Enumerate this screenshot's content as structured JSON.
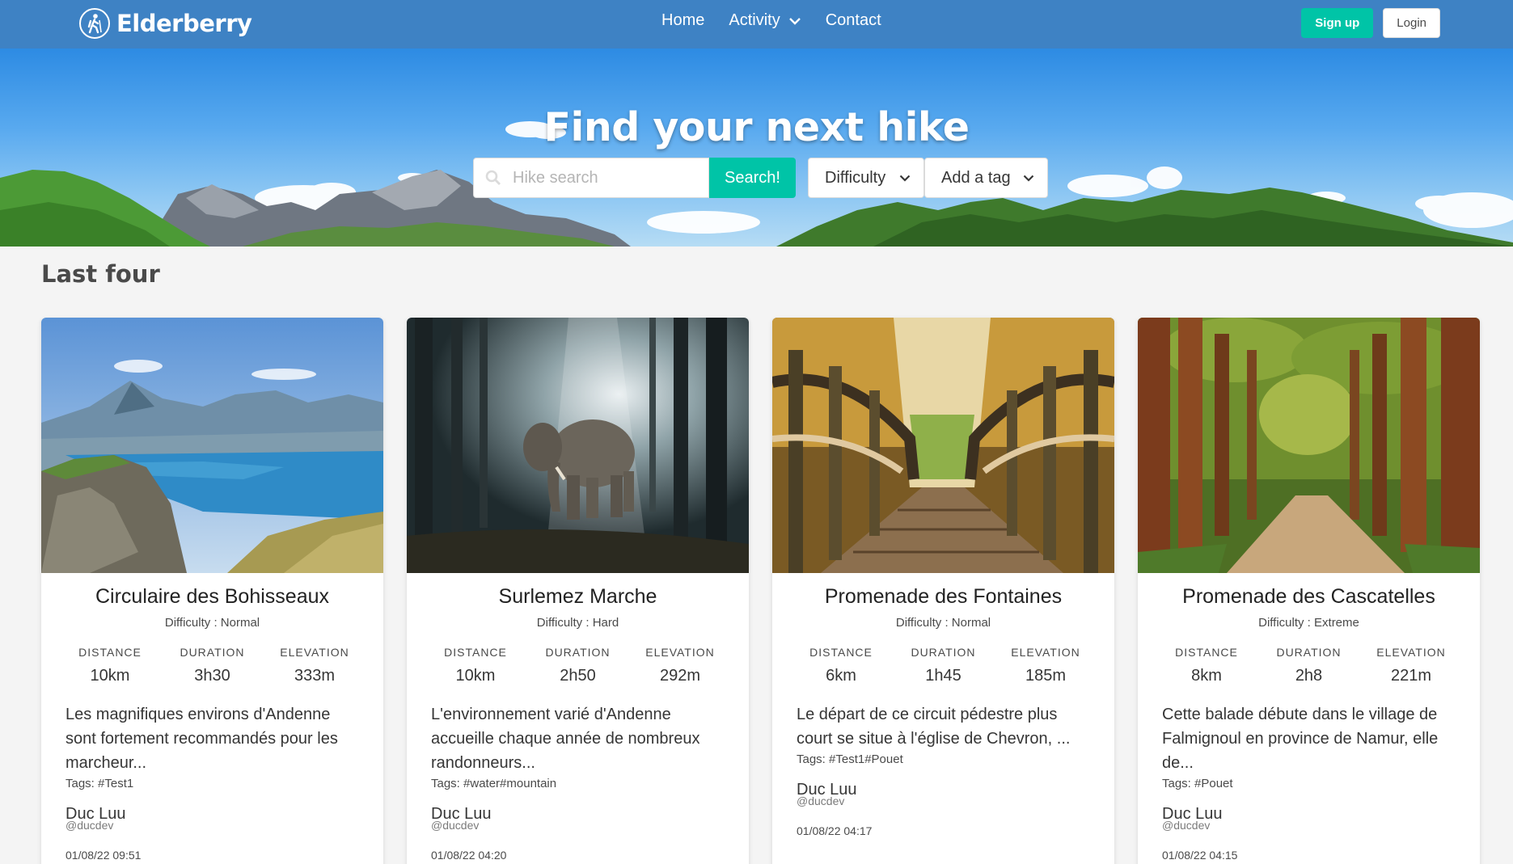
{
  "nav": {
    "brand": "Elderberry",
    "links": [
      "Home",
      "Activity",
      "Contact"
    ],
    "signup": "Sign up",
    "login": "Login"
  },
  "hero": {
    "title": "Find your next hike",
    "search_placeholder": "Hike search",
    "search_button": "Search!",
    "difficulty": "Difficulty",
    "tag": "Add a tag"
  },
  "section_title": "Last four",
  "stat_labels": [
    "DISTANCE",
    "DURATION",
    "ELEVATION"
  ],
  "cards": [
    {
      "title": "Circulaire des Bohisseaux",
      "difficulty": "Difficulty : Normal",
      "distance": "10km",
      "duration": "3h30",
      "elevation": "333m",
      "description": "Les magnifiques environs d'Andenne sont fortement recommandés pour les marcheur...",
      "tags": "Tags: #Test1",
      "author": "Duc Luu",
      "handle": "@ducdev",
      "date": "01/08/22 09:51"
    },
    {
      "title": "Surlemez Marche",
      "difficulty": "Difficulty : Hard",
      "distance": "10km",
      "duration": "2h50",
      "elevation": "292m",
      "description": "L'environnement varié d'Andenne accueille chaque année de nombreux randonneurs...",
      "tags": "Tags: #water#mountain",
      "author": "Duc Luu",
      "handle": "@ducdev",
      "date": "01/08/22 04:20"
    },
    {
      "title": "Promenade des Fontaines",
      "difficulty": "Difficulty : Normal",
      "distance": "6km",
      "duration": "1h45",
      "elevation": "185m",
      "description": "Le départ de ce circuit pédestre plus court se situe à l'église de Chevron, ...",
      "tags": "Tags: #Test1#Pouet",
      "author": "Duc Luu",
      "handle": "@ducdev",
      "date": "01/08/22 04:17"
    },
    {
      "title": "Promenade des Cascatelles",
      "difficulty": "Difficulty : Extreme",
      "distance": "8km",
      "duration": "2h8",
      "elevation": "221m",
      "description": "Cette balade débute dans le village de Falmignoul en province de Namur, elle de...",
      "tags": "Tags: #Pouet",
      "author": "Duc Luu",
      "handle": "@ducdev",
      "date": "01/08/22 04:15"
    }
  ]
}
